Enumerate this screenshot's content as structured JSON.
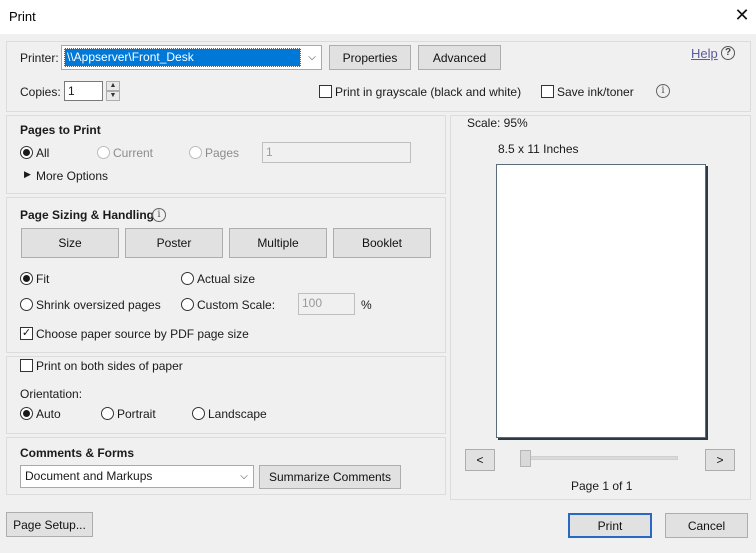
{
  "window": {
    "title": "Print"
  },
  "printer": {
    "label": "Printer:",
    "selected": "\\\\Appserver\\Front_Desk",
    "properties_label": "Properties",
    "advanced_label": "Advanced",
    "help_label": "Help"
  },
  "copies": {
    "label": "Copies:",
    "value": "1",
    "grayscale_label": "Print in grayscale (black and white)",
    "save_ink_label": "Save ink/toner"
  },
  "pages_to_print": {
    "heading": "Pages to Print",
    "all_label": "All",
    "current_label": "Current",
    "pages_label": "Pages",
    "pages_value": "1",
    "more_options_label": "More Options"
  },
  "sizing": {
    "heading": "Page Sizing & Handling",
    "tabs": [
      "Size",
      "Poster",
      "Multiple",
      "Booklet"
    ],
    "fit_label": "Fit",
    "actual_size_label": "Actual size",
    "shrink_label": "Shrink oversized pages",
    "custom_scale_label": "Custom Scale:",
    "custom_scale_value": "100",
    "percent_label": "%",
    "paper_source_label": "Choose paper source by PDF page size"
  },
  "duplex": {
    "both_sides_label": "Print on both sides of paper",
    "orientation_label": "Orientation:",
    "auto_label": "Auto",
    "portrait_label": "Portrait",
    "landscape_label": "Landscape"
  },
  "comments": {
    "heading": "Comments & Forms",
    "selected": "Document and Markups",
    "summarize_label": "Summarize Comments"
  },
  "preview": {
    "scale_text": "Scale:  95%",
    "paper_size_text": "8.5 x 11 Inches",
    "prev_label": "<",
    "next_label": ">",
    "page_text": "Page 1 of 1"
  },
  "footer": {
    "page_setup_label": "Page Setup...",
    "print_label": "Print",
    "cancel_label": "Cancel"
  }
}
